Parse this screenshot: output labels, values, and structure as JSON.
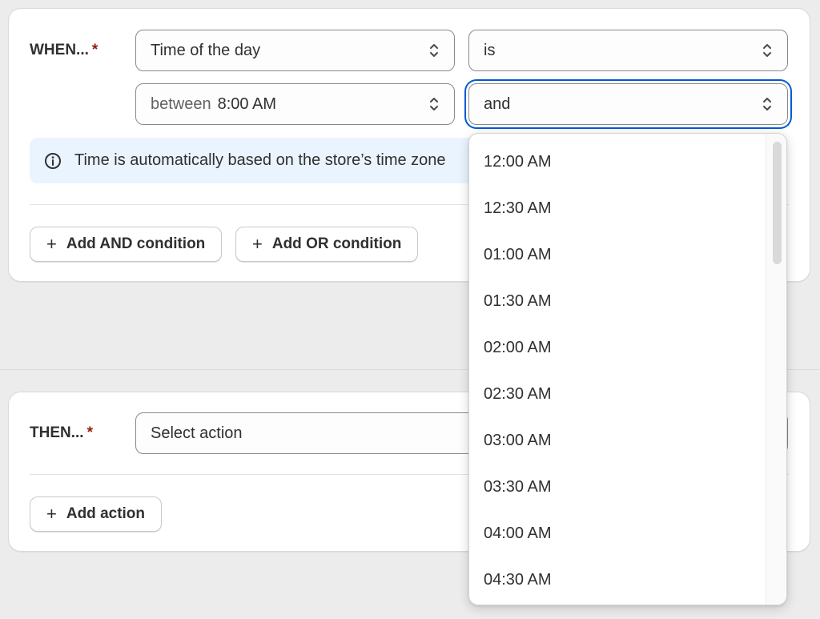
{
  "when": {
    "label": "WHEN...",
    "required_mark": "*",
    "field_select": {
      "value": "Time of the day"
    },
    "operator_select": {
      "value": "is"
    },
    "start_select": {
      "prefix": "between",
      "value": "8:00 AM"
    },
    "end_select": {
      "value": "and"
    },
    "info_text": "Time is automatically based on the store’s time zone",
    "add_and_label": "Add AND condition",
    "add_or_label": "Add OR condition"
  },
  "then": {
    "label": "THEN...",
    "required_mark": "*",
    "action_select": {
      "placeholder": "Select action"
    },
    "add_action_label": "Add action"
  },
  "dropdown": {
    "options": [
      "12:00 AM",
      "12:30 AM",
      "01:00 AM",
      "01:30 AM",
      "02:00 AM",
      "02:30 AM",
      "03:00 AM",
      "03:30 AM",
      "04:00 AM",
      "04:30 AM"
    ]
  },
  "icons": {
    "plus": "+",
    "info": "info-icon",
    "chevron": "chevron-up-down-icon"
  },
  "colors": {
    "required": "#8e1f0b",
    "focus_ring": "#005bd3",
    "info_banner_bg": "#eaf4ff"
  }
}
